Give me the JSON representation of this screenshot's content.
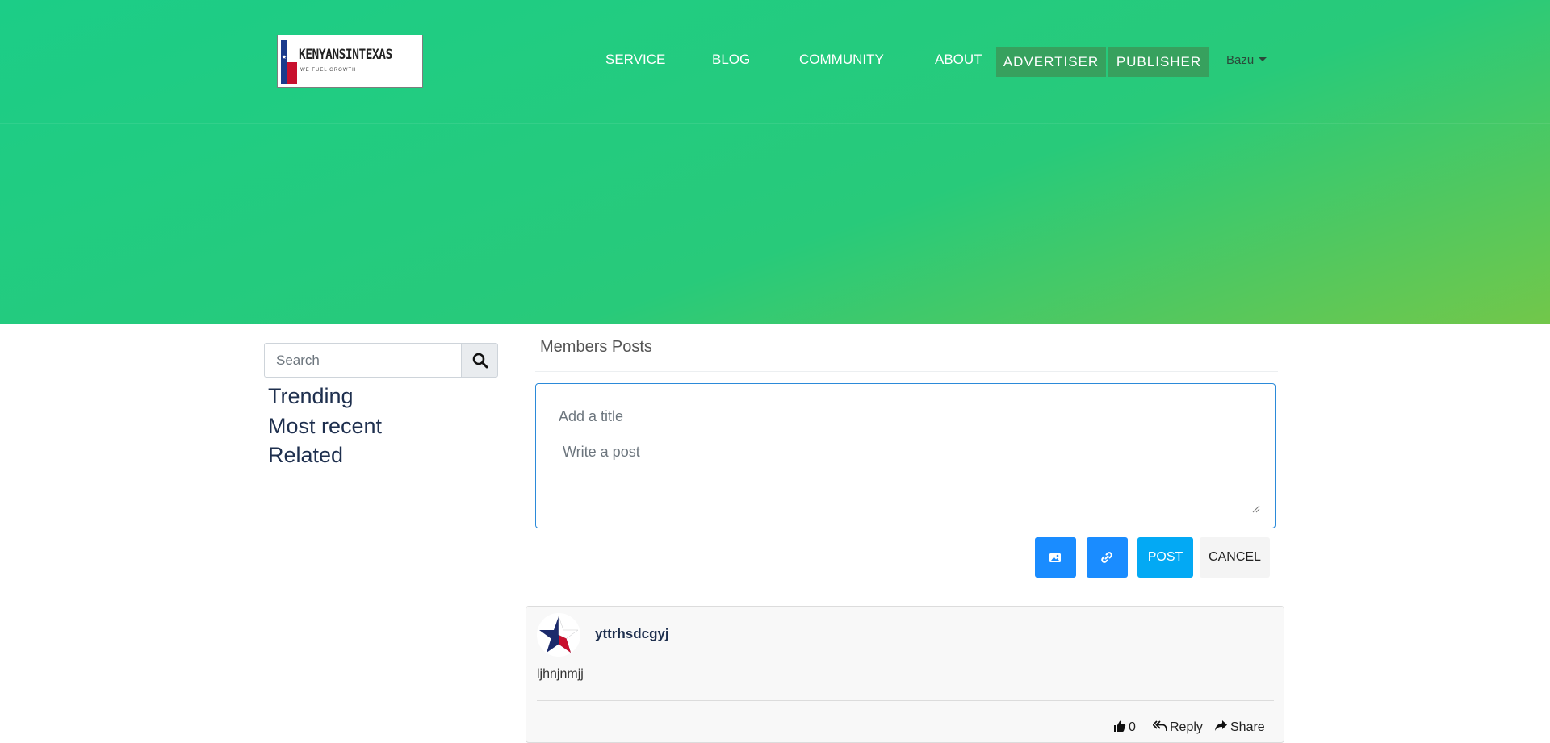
{
  "header": {
    "logo": {
      "title": "KENYANSINTEXAS",
      "tagline": "WE FUEL GROWTH"
    },
    "nav": [
      {
        "label": "SERVICE"
      },
      {
        "label": "BLOG"
      },
      {
        "label": "COMMUNITY"
      },
      {
        "label": "ABOUT"
      }
    ],
    "buttons": {
      "advertiser": "ADVERTISER",
      "publisher": "PUBLISHER"
    },
    "user_menu": "Bazu"
  },
  "sidebar": {
    "search_placeholder": "Search",
    "links": [
      {
        "label": "Trending"
      },
      {
        "label": "Most recent"
      },
      {
        "label": "Related"
      }
    ]
  },
  "main": {
    "section_title": "Members Posts",
    "composer": {
      "title_placeholder": "Add a title",
      "body_placeholder": "Write a post",
      "post_label": "POST",
      "cancel_label": "CANCEL",
      "icons": [
        "image-icon",
        "link-icon"
      ]
    },
    "posts": [
      {
        "author": "yttrhsdcgyj",
        "body": "ljhnjnmjj",
        "likes": "0",
        "reply_label": "Reply",
        "share_label": "Share"
      }
    ]
  },
  "colors": {
    "hero_start": "#1ccd87",
    "hero_end": "#72c74a",
    "nav_button": "#37a15e",
    "primary_blue": "#1a8cff",
    "post_button": "#03a9f4",
    "composer_border": "#2b8ad9"
  }
}
